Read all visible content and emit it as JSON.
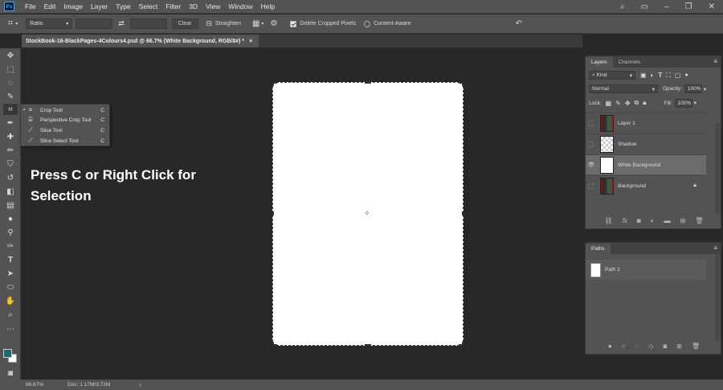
{
  "app": {
    "logo": "Ps",
    "colors": {
      "ui": "#535353",
      "panel_dark": "#424242",
      "canvas_bg": "#282828",
      "accent": "#31a8ff"
    }
  },
  "menubar": {
    "items": [
      "File",
      "Edit",
      "Image",
      "Layer",
      "Type",
      "Select",
      "Filter",
      "3D",
      "View",
      "Window",
      "Help"
    ]
  },
  "options": {
    "ratio": "Ratio",
    "clear": "Clear",
    "straighten": "Straighten",
    "delete_cropped": "Delete Cropped Pixels",
    "content_aware": "Content-Aware"
  },
  "document": {
    "tab_title": "StockBook-16-BlackPages-4Colours4.psd @ 66.7% (White Background, RGB/8#) *",
    "close": "×"
  },
  "flyout": {
    "items": [
      {
        "label": "Crop Tool",
        "key": "C"
      },
      {
        "label": "Perspective Crop Tool",
        "key": "C"
      },
      {
        "label": "Slice Tool",
        "key": "C"
      },
      {
        "label": "Slice Select Tool",
        "key": "C"
      }
    ]
  },
  "overlay": {
    "line1": "Press C or Right Click for",
    "line2": "Selection"
  },
  "status": {
    "zoom": "66.67%",
    "doc": "Doc: 1.17M/3.73M",
    "arrow": "›"
  },
  "layers_panel": {
    "tabs": [
      "Layers",
      "Channels"
    ],
    "filter": "Kind",
    "blend_mode": "Normal",
    "opacity_label": "Opacity:",
    "opacity": "100%",
    "lock_label": "Lock:",
    "fill_label": "Fill:",
    "fill": "100%",
    "layers": [
      {
        "name": "Layer 1",
        "visible": false
      },
      {
        "name": "Shadow",
        "visible": false
      },
      {
        "name": "White Background",
        "visible": true,
        "selected": true
      },
      {
        "name": "Background",
        "visible": false,
        "locked": true
      }
    ]
  },
  "paths_panel": {
    "tab": "Paths",
    "items": [
      "Path 1"
    ]
  }
}
